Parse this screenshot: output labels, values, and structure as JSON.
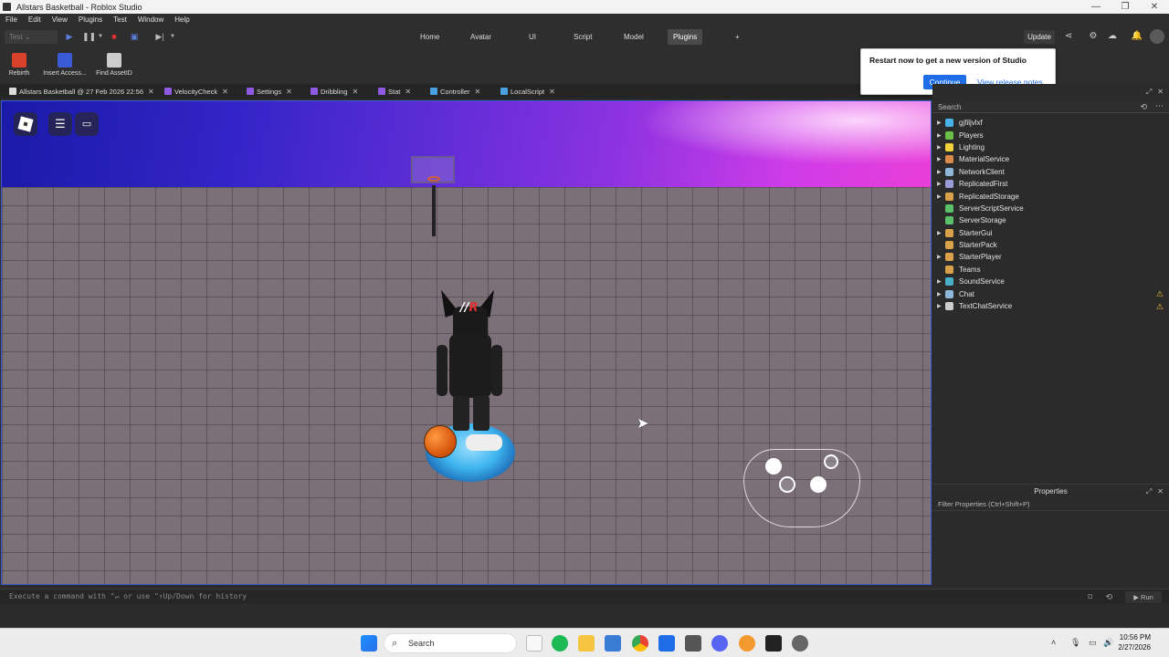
{
  "window": {
    "title": "Allstars Basketball - Roblox Studio",
    "controls": [
      "—",
      "❐",
      "✕"
    ]
  },
  "menu": [
    "File",
    "Edit",
    "View",
    "Plugins",
    "Test",
    "Window",
    "Help"
  ],
  "toolbar": {
    "test_select": "Test",
    "tabs": [
      {
        "label": "Home"
      },
      {
        "label": "Avatar"
      },
      {
        "label": "UI"
      },
      {
        "label": "Script"
      },
      {
        "label": "Model"
      },
      {
        "label": "Plugins"
      },
      {
        "label": "+"
      }
    ],
    "update_label": "Update"
  },
  "plugins": [
    {
      "label": "Rebirth",
      "color": "#d9412b"
    },
    {
      "label": "Insert Access...",
      "color": "#3a5ad6"
    },
    {
      "label": "Find AssetID",
      "color": "#cccccc"
    }
  ],
  "restart_popup": {
    "message": "Restart now to get a new version of Studio",
    "continue_label": "Continue",
    "notes_label": "View release notes"
  },
  "doc_tabs": [
    {
      "label": "Allstars Basketball @ 27 Feb 2026 22:56",
      "color": "#dddddd"
    },
    {
      "label": "VelocityCheck",
      "color": "#8d5ae0"
    },
    {
      "label": "Settings",
      "color": "#8d5ae0"
    },
    {
      "label": "Dribbling",
      "color": "#8d5ae0"
    },
    {
      "label": "Stat",
      "color": "#8d5ae0"
    },
    {
      "label": "Controller",
      "color": "#4aa0e0"
    },
    {
      "label": "LocalScript",
      "color": "#4aa0e0"
    }
  ],
  "explorer": {
    "search_placeholder": "Search",
    "items": [
      {
        "label": "gjfiljvlxf",
        "color": "#4ab0e8",
        "expandable": true,
        "warn": false
      },
      {
        "label": "Players",
        "color": "#6cc04a",
        "expandable": true,
        "warn": false
      },
      {
        "label": "Lighting",
        "color": "#f2d23a",
        "expandable": true,
        "warn": false
      },
      {
        "label": "MaterialService",
        "color": "#d98a4a",
        "expandable": true,
        "warn": false
      },
      {
        "label": "NetworkClient",
        "color": "#8fb8d8",
        "expandable": true,
        "warn": false
      },
      {
        "label": "ReplicatedFirst",
        "color": "#9a9ad8",
        "expandable": true,
        "warn": false
      },
      {
        "label": "ReplicatedStorage",
        "color": "#d9a24a",
        "expandable": true,
        "warn": false
      },
      {
        "label": "ServerScriptService",
        "color": "#5ac06a",
        "expandable": false,
        "warn": false
      },
      {
        "label": "ServerStorage",
        "color": "#5ac06a",
        "expandable": false,
        "warn": false
      },
      {
        "label": "StarterGui",
        "color": "#d9a24a",
        "expandable": true,
        "warn": false
      },
      {
        "label": "StarterPack",
        "color": "#d9a24a",
        "expandable": false,
        "warn": false
      },
      {
        "label": "StarterPlayer",
        "color": "#d9a24a",
        "expandable": true,
        "warn": false
      },
      {
        "label": "Teams",
        "color": "#d9a24a",
        "expandable": false,
        "warn": false
      },
      {
        "label": "SoundService",
        "color": "#4ab0c8",
        "expandable": true,
        "warn": false
      },
      {
        "label": "Chat",
        "color": "#8fb8d8",
        "expandable": true,
        "warn": true
      },
      {
        "label": "TextChatService",
        "color": "#cccccc",
        "expandable": true,
        "warn": true
      }
    ]
  },
  "properties": {
    "title": "Properties",
    "filter_placeholder": "Filter Properties (Ctrl+Shift+P)"
  },
  "command_bar": {
    "placeholder": "Execute a command with \"↵ or use \"↑Up/Down for history",
    "run_label": "Run"
  },
  "taskbar": {
    "search_label": "Search",
    "time": "10:56 PM",
    "date": "2/27/2026"
  }
}
